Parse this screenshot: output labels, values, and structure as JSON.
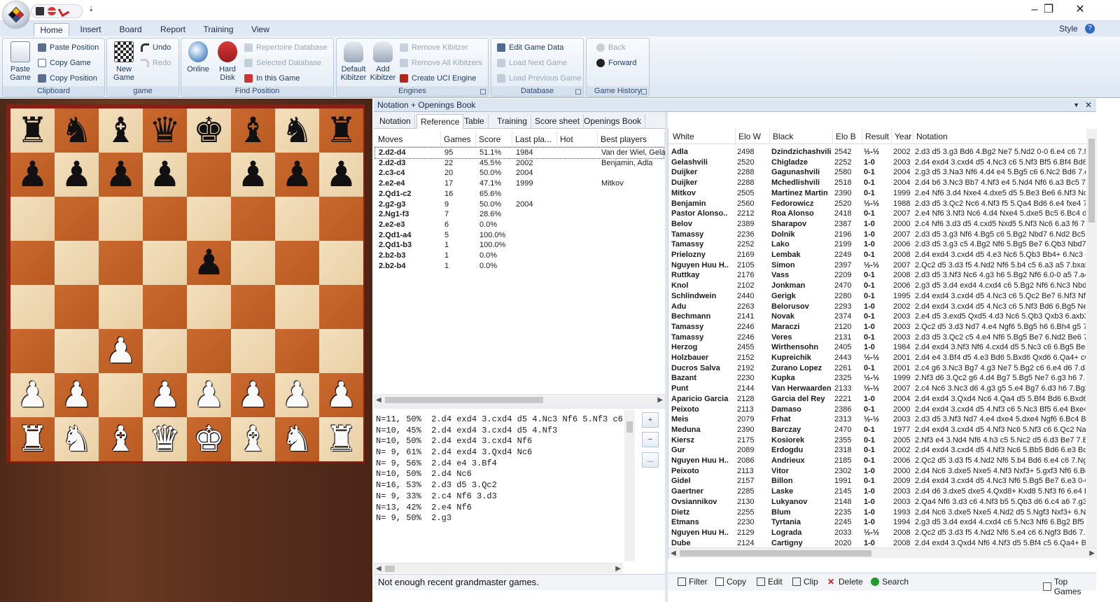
{
  "title_bar": {
    "minimize": "–",
    "maximize": "❐",
    "close": "✕",
    "qat_more": "⇣"
  },
  "ribbon_tabs": [
    "Home",
    "Insert",
    "Board",
    "Report",
    "Training",
    "View"
  ],
  "style_label": "Style",
  "help_label": "?",
  "ribbon": {
    "clipboard": {
      "label": "Clipboard",
      "paste_game": "Paste Game",
      "paste_position": "Paste Position",
      "copy_game": "Copy Game",
      "copy_position": "Copy Position"
    },
    "game": {
      "label": "game",
      "new_game": "New Game",
      "undo": "Undo",
      "redo": "Redo"
    },
    "find_position": {
      "label": "Find Position",
      "online": "Online",
      "hard_disk": "Hard Disk",
      "repertoire_database": "Repertoire Database",
      "selected_database": "Selected Database",
      "in_this_game": "In this Game"
    },
    "engines": {
      "label": "Engines",
      "default_kibitzer": "Default Kibitzer",
      "add_kibitzer": "Add Kibitzer",
      "remove_kibitzer": "Remove Kibitzer",
      "remove_all_kibitzers": "Remove All Kibitzers",
      "create_uci_engine": "Create UCI Engine"
    },
    "database": {
      "label": "Database",
      "edit_game_data": "Edit Game Data",
      "load_next_game": "Load Next Game",
      "load_previous_game": "Load Previous Game"
    },
    "game_history": {
      "label": "Game History",
      "back": "Back",
      "forward": "Forward"
    }
  },
  "board": {
    "ranks": [
      [
        "r",
        "n",
        "b",
        "q",
        "k",
        "b",
        "n",
        "r"
      ],
      [
        "p",
        "p",
        "p",
        "p",
        "",
        "p",
        "p",
        "p"
      ],
      [
        "",
        "",
        "",
        "",
        "",
        "",
        "",
        ""
      ],
      [
        "",
        "",
        "",
        "",
        "p",
        "",
        "",
        ""
      ],
      [
        "",
        "",
        "",
        "",
        "",
        "",
        "",
        ""
      ],
      [
        "",
        "",
        "P",
        "",
        "",
        "",
        "",
        ""
      ],
      [
        "P",
        "P",
        "",
        "P",
        "P",
        "P",
        "P",
        "P"
      ],
      [
        "R",
        "N",
        "B",
        "Q",
        "K",
        "B",
        "N",
        "R"
      ]
    ],
    "glyphs": {
      "r": "♜",
      "n": "♞",
      "b": "♝",
      "q": "♛",
      "k": "♚",
      "p": "♟",
      "R": "♜",
      "N": "♞",
      "B": "♝",
      "Q": "♛",
      "K": "♚",
      "P": "♟"
    }
  },
  "panel": {
    "title": "Notation + Openings Book",
    "tabs": [
      "Notation",
      "Reference",
      "Table",
      "Training",
      "Score sheet",
      "Openings Book"
    ],
    "active_tab": "Reference",
    "moves_headers": [
      "Moves",
      "Games",
      "Score",
      "Last pla...",
      "Hot",
      "Best players"
    ],
    "moves": [
      [
        "2.d2-d4",
        "95",
        "51.1%",
        "1984",
        "",
        "Van der Wiel, Gela"
      ],
      [
        "2.d2-d3",
        "22",
        "45.5%",
        "2002",
        "",
        "Benjamin, Adla"
      ],
      [
        "2.c3-c4",
        "20",
        "50.0%",
        "2004",
        "",
        ""
      ],
      [
        "2.e2-e4",
        "17",
        "47.1%",
        "1999",
        "",
        "Mitkov"
      ],
      [
        "2.Qd1-c2",
        "16",
        "65.6%",
        "",
        "",
        ""
      ],
      [
        "2.g2-g3",
        "9",
        "50.0%",
        "2004",
        "",
        ""
      ],
      [
        "2.Ng1-f3",
        "7",
        "28.6%",
        "",
        "",
        ""
      ],
      [
        "2.e2-e3",
        "6",
        "0.0%",
        "",
        "",
        ""
      ],
      [
        "2.Qd1-a4",
        "5",
        "100.0%",
        "",
        "",
        ""
      ],
      [
        "2.Qd1-b3",
        "1",
        "100.0%",
        "",
        "",
        ""
      ],
      [
        "2.b2-b3",
        "1",
        "0.0%",
        "",
        "",
        ""
      ],
      [
        "2.b2-b4",
        "1",
        "0.0%",
        "",
        "",
        ""
      ]
    ],
    "lines": [
      "N=11, 50%  2.d4 exd4 3.cxd4 d5 4.Nc3 Nf6 5.Nf3 c6",
      "N=10, 45%  2.d4 exd4 3.cxd4 d5 4.Nf3",
      "N=10, 50%  2.d4 exd4 3.cxd4 Nf6",
      "N= 9, 61%  2.d4 exd4 3.Qxd4 Nc6",
      "N= 9, 56%  2.d4 e4 3.Bf4",
      "N=10, 50%  2.d4 Nc6",
      "N=16, 53%  2.d3 d5 3.Qc2",
      "N= 9, 33%  2.c4 Nf6 3.d3",
      "N=13, 42%  2.e4 Nf6",
      "N= 9, 50%  2.g3"
    ],
    "side_buttons": [
      "+",
      "−",
      "..."
    ],
    "status": "Not enough recent grandmaster games."
  },
  "games": {
    "headers": [
      "White",
      "Elo W",
      "Black",
      "Elo B",
      "Result",
      "Year",
      "Notation"
    ],
    "rows": [
      [
        "Adla",
        "2498",
        "Dzindzichashvili",
        "2542",
        "½-½",
        "2002",
        "2.d3 d5 3.g3 Bd6 4.Bg2 Ne7 5.Nd2 0-0 6.e4 c6 7.Ng"
      ],
      [
        "Gelashvili",
        "2520",
        "Chigladze",
        "2252",
        "1-0",
        "2003",
        "2.d4 exd4 3.cxd4 d5 4.Nc3 c6 5.Nf3 Bf5 6.Bf4 Bd6 7."
      ],
      [
        "Duijker",
        "2288",
        "Gagunashvili",
        "2580",
        "0-1",
        "2004",
        "2.g3 d5 3.Na3 Nf6 4.d4 e4 5.Bg5 c6 6.Nc2 Bd6 7.e3"
      ],
      [
        "Duijker",
        "2288",
        "Mchedlishvili",
        "2518",
        "0-1",
        "2004",
        "2.d4 b6 3.Nc3 Bb7 4.Nf3 e4 5.Nd4 Nf6 6.a3 Bc5 7.Nf"
      ],
      [
        "Mitkov",
        "2505",
        "Martinez Martin",
        "2390",
        "0-1",
        "1999",
        "2.e4 Nf6 3.d4 Nxe4 4.dxe5 d5 5.Be3 Be6 6.Nf3 Nd7"
      ],
      [
        "Benjamin",
        "2560",
        "Fedorowicz",
        "2520",
        "½-½",
        "1988",
        "2.d3 d5 3.Qc2 Nc6 4.Nf3 f5 5.Qa4 Bd6 6.e4 fxe4 7."
      ],
      [
        "Pastor Alonso..",
        "2212",
        "Roa Alonso",
        "2418",
        "0-1",
        "2007",
        "2.e4 Nf6 3.Nf3 Nc6 4.d4 Nxe4 5.dxe5 Bc5 6.Bc4 d5 7"
      ],
      [
        "Belov",
        "2389",
        "Sharapov",
        "2387",
        "1-0",
        "2000",
        "2.c4 Nf6 3.d3 d5 4.cxd5 Nxd5 5.Nf3 Nc6 6.a3 f6 7.e"
      ],
      [
        "Tamassy",
        "2236",
        "Dolnik",
        "2196",
        "1-0",
        "2007",
        "2.d3 d5 3.g3 Nf6 4.Bg5 c6 5.Bg2 Nbd7 6.Nd2 Bc5 7"
      ],
      [
        "Tamassy",
        "2252",
        "Lako",
        "2199",
        "1-0",
        "2006",
        "2.d3 d5 3.g3 c5 4.Bg2 Nf6 5.Bg5 Be7 6.Qb3 Nbd7 7"
      ],
      [
        "Prielozny",
        "2169",
        "Lembak",
        "2249",
        "0-1",
        "2008",
        "2.d4 exd4 3.cxd4 d5 4.e3 Nc6 5.Qb3 Bb4+ 6.Nc3 Qe"
      ],
      [
        "Nguyen Huu H..",
        "2105",
        "Simon",
        "2397",
        "½-½",
        "2007",
        "2.Qc2 d5 3.d3 f5 4.Nd2 Nf6 5.b4 c5 6.a3 a5 7.bxa5 N"
      ],
      [
        "Ruttkay",
        "2176",
        "Vass",
        "2209",
        "0-1",
        "2008",
        "2.d3 d5 3.Nf3 Nc6 4.g3 h6 5.Bg2 Nf6 6.0-0 a5 7.a4 E"
      ],
      [
        "Knol",
        "2102",
        "Jonkman",
        "2470",
        "0-1",
        "2006",
        "2.g3 d5 3.d4 exd4 4.cxd4 c6 5.Bg2 Nf6 6.Nc3 Nbd7"
      ],
      [
        "Schlindwein",
        "2440",
        "Gerigk",
        "2280",
        "0-1",
        "1995",
        "2.d4 exd4 3.cxd4 d5 4.Nc3 c6 5.Qc2 Be7 6.Nf3 Nf6 7"
      ],
      [
        "Adu",
        "2263",
        "Belorusov",
        "2293",
        "1-0",
        "2002",
        "2.d4 exd4 3.cxd4 d5 4.Nc3 c6 5.Nf3 Bd6 6.Bg5 Ne7"
      ],
      [
        "Bechmann",
        "2141",
        "Novak",
        "2374",
        "0-1",
        "2003",
        "2.e4 d5 3.exd5 Qxd5 4.d3 Nc6 5.Qb3 Qxb3 6.axb3 E"
      ],
      [
        "Tamassy",
        "2246",
        "Maraczi",
        "2120",
        "1-0",
        "2003",
        "2.Qc2 d5 3.d3 Nd7 4.e4 Ngf6 5.Bg5 h6 6.Bh4 g5 7.B"
      ],
      [
        "Tamassy",
        "2246",
        "Veres",
        "2131",
        "0-1",
        "2003",
        "2.d3 d5 3.Qc2 c5 4.e4 Nf6 5.Bg5 Be7 6.Nd2 Be6 7.N"
      ],
      [
        "Herzog",
        "2455",
        "Wirthensohn",
        "2405",
        "1-0",
        "1984",
        "2.d4 exd4 3.Nf3 Nf6 4.cxd4 d5 5.Nc3 c6 6.Bg5 Be7 7"
      ],
      [
        "Holzbauer",
        "2152",
        "Kupreichik",
        "2443",
        "½-½",
        "2001",
        "2.d4 e4 3.Bf4 d5 4.e3 Bd6 5.Bxd6 Qxd6 6.Qa4+ c6 7"
      ],
      [
        "Ducros Salva",
        "2192",
        "Zurano Lopez",
        "2261",
        "0-1",
        "2001",
        "2.c4 g6 3.Nc3 Bg7 4.g3 Ne7 5.Bg2 c6 6.e4 d6 7.d3 0"
      ],
      [
        "Bazant",
        "2230",
        "Kupka",
        "2325",
        "½-½",
        "1999",
        "2.Nf3 d6 3.Qc2 g6 4.d4 Bg7 5.Bg5 Ne7 6.g3 h6 7.Bx"
      ],
      [
        "Punt",
        "2144",
        "Van Herwaarden",
        "2133",
        "½-½",
        "2007",
        "2.c4 Nc6 3.Nc3 d6 4.g3 g5 5.e4 Bg7 6.d3 h6 7.Bg2 N"
      ],
      [
        "Aparicio Garcia",
        "2128",
        "Garcia del Rey",
        "2221",
        "1-0",
        "2004",
        "2.d4 exd4 3.Qxd4 Nc6 4.Qa4 d5 5.Bf4 Bd6 6.Bxd6 Qx"
      ],
      [
        "Peixoto",
        "2113",
        "Damaso",
        "2386",
        "0-1",
        "2000",
        "2.d4 exd4 3.cxd4 d5 4.Nf3 c6 5.Nc3 Bf5 6.e4 Bxe4 7."
      ],
      [
        "Meis",
        "2079",
        "Frhat",
        "2313",
        "½-½",
        "2003",
        "2.d3 d5 3.Nf3 Nd7 4.e4 dxe4 5.dxe4 Ngf6 6.Bc4 Bc5 7"
      ],
      [
        "Meduna",
        "2390",
        "Barczay",
        "2470",
        "0-1",
        "1977",
        "2.d4 exd4 3.cxd4 d5 4.Nf3 Nc6 5.Nf3 c6 6.Qc2 Na6 7"
      ],
      [
        "Kiersz",
        "2175",
        "Kosiorek",
        "2355",
        "0-1",
        "2005",
        "2.Nf3 e4 3.Nd4 Nf6 4.h3 c5 5.Nc2 d5 6.d3 Be7 7.Bg5"
      ],
      [
        "Gur",
        "2089",
        "Erdogdu",
        "2318",
        "0-1",
        "2002",
        "2.d4 exd4 3.cxd4 d5 4.Nf3 Nc6 5.Bb5 Bd6 6.e3 Bc3 7.c"
      ],
      [
        "Nguyen Huu H..",
        "2086",
        "Andrieux",
        "2185",
        "0-1",
        "2006",
        "2.Qc2 d5 3.d3 f5 4.Nd2 Nf6 5.b4 Bd6 6.e4 c6 7.Ngf3"
      ],
      [
        "Peixoto",
        "2113",
        "Vitor",
        "2302",
        "1-0",
        "2000",
        "2.d4 Nc6 3.dxe5 Nxe5 4.Nf3 Nxf3+ 5.gxf3 Nf6 6.Bg5"
      ],
      [
        "Gidel",
        "2157",
        "Billon",
        "1991",
        "0-1",
        "2009",
        "2.d4 exd4 3.cxd4 d5 4.Nc3 Nf6 5.Bg5 Be7 6.e3 0-0 7"
      ],
      [
        "Gaertner",
        "2285",
        "Laske",
        "2145",
        "1-0",
        "2003",
        "2.d4 d6 3.dxe5 dxe5 4.Qxd8+ Kxd8 5.Nf3 f6 6.e4 Bc"
      ],
      [
        "Ovsiannikov",
        "2130",
        "Lukyanov",
        "2148",
        "1-0",
        "2003",
        "2.Qa4 Nf6 3.d3 c6 4.Nf3 b5 5.Qb3 d6 6.c4 a6 7.g3 B"
      ],
      [
        "Dietz",
        "2255",
        "Blum",
        "2235",
        "1-0",
        "1993",
        "2.d4 Nc6 3.dxe5 Nxe5 4.Nd2 d5 5.Ngf3 Nxf3+ 6.Nxf"
      ],
      [
        "Etmans",
        "2230",
        "Tyrtania",
        "2245",
        "1-0",
        "1994",
        "2.g3 d5 3.d4 exd4 4.cxd4 c6 5.Nc3 Nf6 6.Bg2 Bf5 7.0"
      ],
      [
        "Nguyen Huu H..",
        "2129",
        "Lograda",
        "2033",
        "½-½",
        "2008",
        "2.Qc2 d5 3.d3 f5 4.Nd2 Nf6 5.e4 c6 6.Ngf3 Bd6 7.Be"
      ],
      [
        "Dube",
        "2124",
        "Cartigny",
        "2020",
        "1-0",
        "2008",
        "2.d4 exd4 3.Qxd4 Nf6 4.Nf3 d5 5.Bf4 c5 6.Qa4+ Bd7"
      ]
    ],
    "toolbar": [
      "Filter",
      "Copy",
      "Edit",
      "Clip",
      "Delete",
      "Search"
    ],
    "top_games": "Top Games"
  }
}
